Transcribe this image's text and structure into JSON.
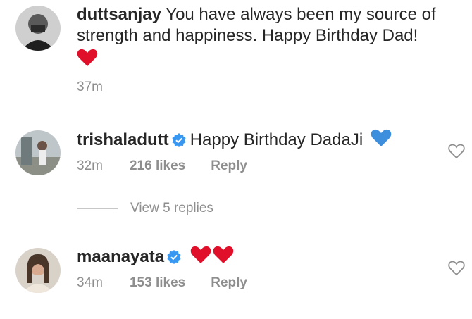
{
  "caption": {
    "username": "duttsanjay",
    "text": "You have always been my source of strength and happiness. Happy Birthday Dad!",
    "emoji": "red-heart",
    "time": "37m"
  },
  "comments": [
    {
      "username": "trishaladutt",
      "verified": true,
      "text": "Happy Birthday DadaJi",
      "emoji": "blue-heart",
      "time": "32m",
      "likes": "216 likes",
      "reply_label": "Reply"
    },
    {
      "username": "maanayata",
      "verified": true,
      "text": "",
      "emoji": "two-red-hearts",
      "time": "34m",
      "likes": "153 likes",
      "reply_label": "Reply"
    }
  ],
  "view_replies": "View 5 replies",
  "colors": {
    "text": "#262626",
    "muted": "#8e8e8e",
    "verified_blue": "#3897f0",
    "red_heart": "#e0102a",
    "blue_heart": "#3e8ede"
  }
}
